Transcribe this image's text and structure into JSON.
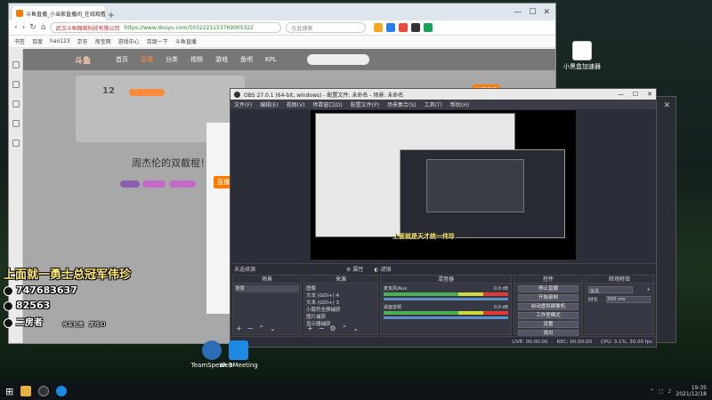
{
  "browser": {
    "tab_title": "斗鱼直播_小当家直播间_在线观看",
    "url_host": "武汉斗鱼网络科技有限公司",
    "url": "https://www.douyu.com/5032221153769005322",
    "search_placeholder": "在此搜索",
    "bookmarks": [
      "书签",
      "百度",
      "hao123",
      "京东",
      "淘宝网",
      "游戏中心",
      "百度一下",
      "斗鱼直播"
    ]
  },
  "site": {
    "logo": "斗鱼",
    "nav": [
      "首页",
      "直播",
      "分类",
      "视频",
      "游戏",
      "鱼吧",
      "KPL"
    ],
    "active_nav": "直播",
    "panel_number": "12",
    "promo_title": "周杰伦的双截棍！",
    "orange_tag": "直播信息",
    "pc_client": "PC客户端"
  },
  "obs": {
    "window_title": "OBS 27.0.1 (64-bit, windows) - 配置文件: 未命名 - 场景: 未命名",
    "menu": [
      "文件(F)",
      "编辑(E)",
      "视图(V)",
      "停靠窗口(D)",
      "配置文件(P)",
      "场景集合(S)",
      "工具(T)",
      "帮助(H)"
    ],
    "preview_overlay_text": "上面就是天才统一伟珍",
    "scene_bar": {
      "label": "未选择源",
      "properties": "属性",
      "filters": "滤镜"
    },
    "docks": {
      "scenes": {
        "header": "场景",
        "items": [
          "场景"
        ]
      },
      "sources": {
        "header": "来源",
        "items": [
          "图像",
          "文本 (GDI+) 4",
          "文本 (GDI+) 3",
          "小篇符全屏捕获",
          "图片捕获",
          "显示器捕获"
        ]
      },
      "mixer": {
        "header": "混音器",
        "channels": [
          {
            "name": "麦克风/Aux",
            "level": "0.0 dB"
          },
          {
            "name": "桌面音频",
            "level": "0.0 dB"
          }
        ]
      },
      "controls": {
        "header": "控件",
        "buttons": [
          "停止直播",
          "开始录制",
          "启动虚拟摄像机",
          "工作室模式",
          "设置",
          "退出"
        ]
      },
      "transitions": {
        "header": "转场特效",
        "type": "淡出",
        "duration_label": "时长",
        "duration": "300 ms"
      }
    },
    "status": {
      "live": "LIVE: 00:00:00",
      "rec": "REC: 00:00:00",
      "cpu": "CPU: 3.1%, 30.00 fps"
    }
  },
  "overlay": {
    "line1": "上面就一勇士总冠军伟珍",
    "line2": "747683637",
    "line3": "82563",
    "line4": "二房者"
  },
  "desktop": {
    "icons": [
      "TeamSpeak 3",
      "WebMeeting"
    ],
    "app_icon_label": "小黑盒加速器",
    "bottom_labels": [
      "水友礼盒",
      "游戏ID"
    ]
  },
  "taskbar": {
    "time": "19:35",
    "date": "2021/12/18"
  },
  "colors": {
    "obs_bg": "#2b2e38",
    "douyu_orange": "#ff7a00",
    "overlay_text": "#ffeb70"
  }
}
